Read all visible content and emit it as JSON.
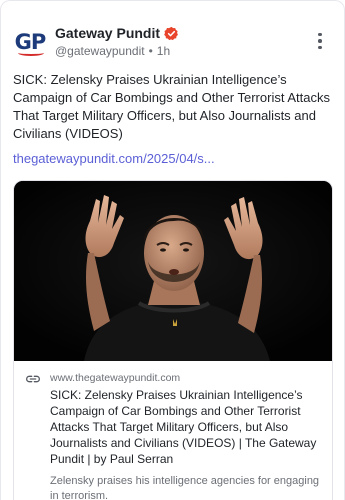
{
  "account": {
    "display_name": "Gateway Pundit",
    "handle": "@gatewaypundit",
    "separator": "•",
    "time_ago": "1h",
    "avatar_text_g": "G",
    "avatar_text_p": "P",
    "verified_icon": "verified-badge-icon",
    "verified_color": "#e8452c"
  },
  "post": {
    "text": "SICK: Zelensky Praises Ukrainian Intelligence’s Campaign of Car Bombings and Other Terrorist Attacks That Target Military Officers, but Also Journalists and Civilians (VIDEOS)",
    "link_text": "thegatewaypundit.com/2025/04/s...",
    "link_color": "#5b5fd6"
  },
  "link_card": {
    "domain": "www.thegatewaypundit.com",
    "title": "SICK: Zelensky Praises Ukrainian Intelligence’s Campaign of Car Bombings and Other Terrorist Attacks That Target Military Officers, but Also Journalists and Civilians (VIDEOS) | The Gateway Pundit | by Paul Serran",
    "description": "Zelensky praises his intelligence agencies for engaging in terrorism.",
    "icon": "link-icon",
    "image_subject": "man in black t-shirt gesturing with raised hands on black background"
  },
  "menu": {
    "icon": "more-vertical-icon"
  }
}
